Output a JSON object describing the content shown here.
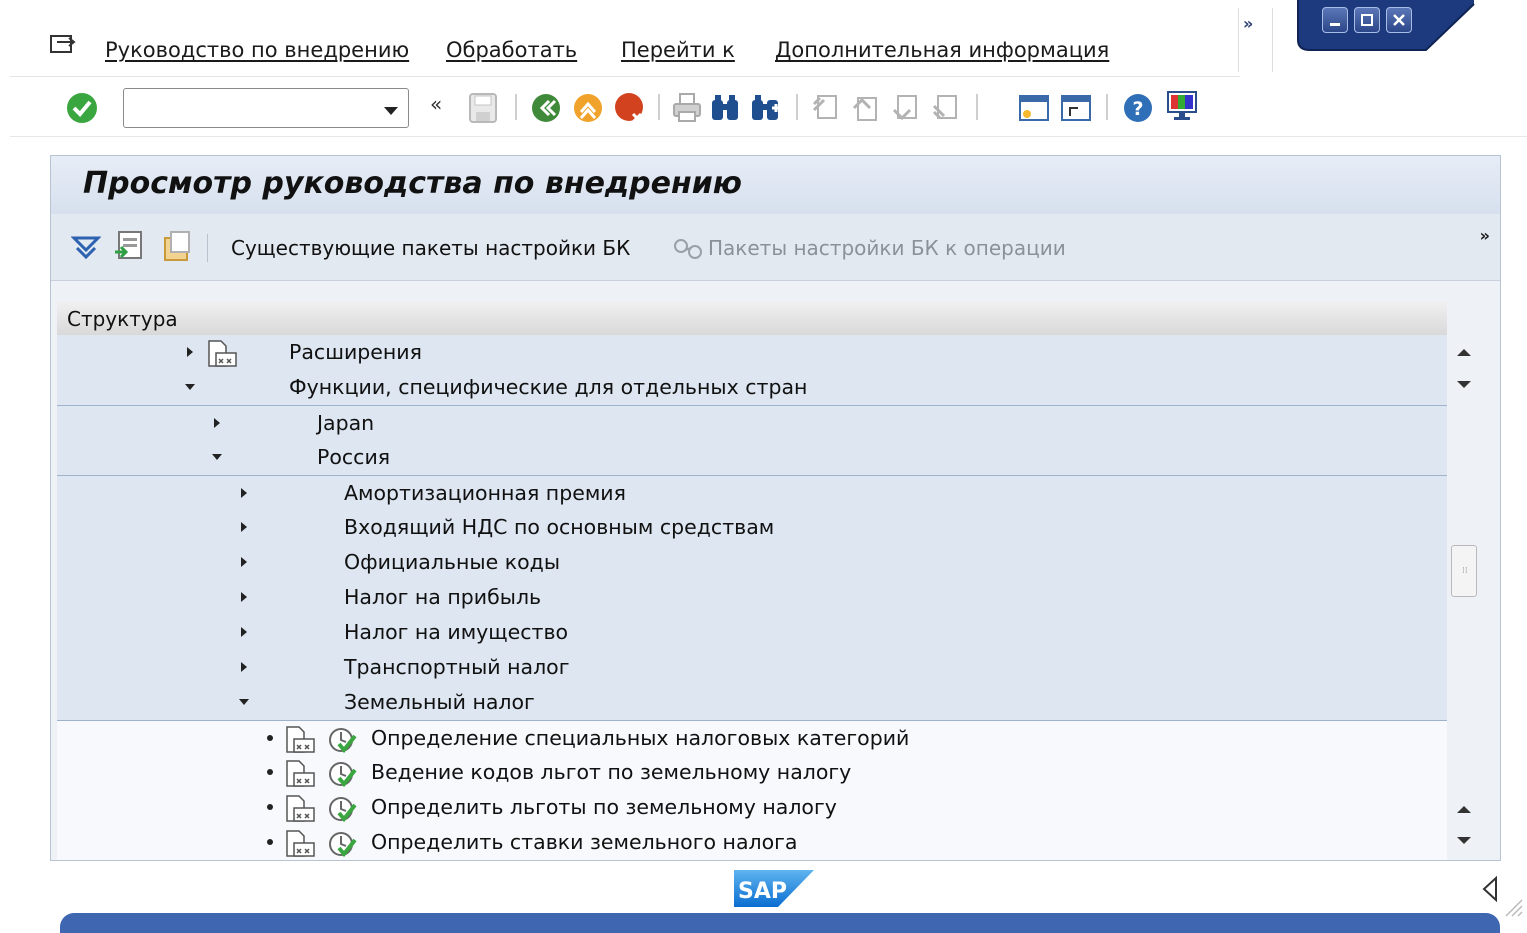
{
  "menubar": {
    "items": [
      "Руководство по внедрению",
      "Обработать",
      "Перейти к",
      "Дополнительная информация"
    ],
    "more": "»"
  },
  "toolbar": {
    "command_value": "",
    "back_double": "«"
  },
  "screen": {
    "title": "Просмотр руководства по внедрению",
    "buttons": {
      "existing_bc_sets": "Существующие пакеты настройки БК",
      "bc_sets_for_activity": "Пакеты настройки БК к операции"
    },
    "more": "»"
  },
  "tree": {
    "header": "Структура",
    "rows": [
      {
        "label": "Расширения",
        "expander": "collapsed"
      },
      {
        "label": "Функции, специфические для отдельных стран",
        "expander": "expanded"
      },
      {
        "label": "Japan",
        "expander": "collapsed"
      },
      {
        "label": "Россия",
        "expander": "expanded"
      },
      {
        "label": "Амортизационная премия",
        "expander": "collapsed"
      },
      {
        "label": "Входящий НДС по основным средствам",
        "expander": "collapsed"
      },
      {
        "label": "Официальные коды",
        "expander": "collapsed"
      },
      {
        "label": "Налог на прибыль",
        "expander": "collapsed"
      },
      {
        "label": "Налог на имущество",
        "expander": "collapsed"
      },
      {
        "label": "Транспортный налог",
        "expander": "collapsed"
      },
      {
        "label": "Земельный налог",
        "expander": "expanded"
      },
      {
        "label": "Определение специальных налоговых категорий",
        "expander": "leaf"
      },
      {
        "label": "Ведение кодов льгот по земельному налогу",
        "expander": "leaf"
      },
      {
        "label": "Определить льготы по земельному налогу",
        "expander": "leaf"
      },
      {
        "label": "Определить ставки земельного налога",
        "expander": "leaf"
      }
    ]
  },
  "footer": {
    "logo": "SAP"
  },
  "colors": {
    "accent": "#3f66b1",
    "title_bg": "#dfe7f2",
    "tree_shaded": "#dde6f1",
    "enter_green": "#3aa640"
  }
}
